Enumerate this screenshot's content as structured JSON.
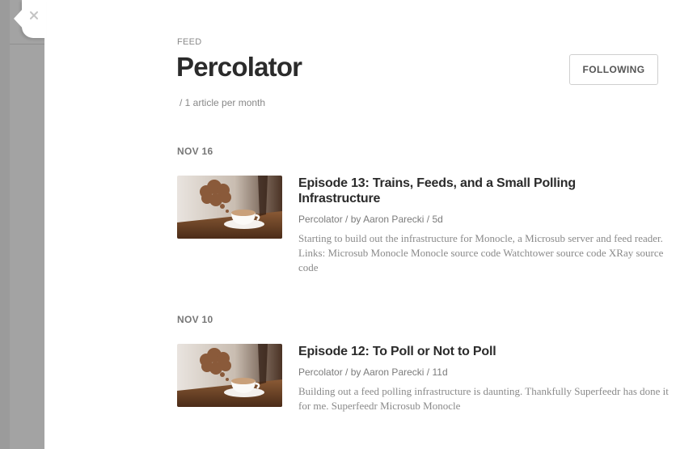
{
  "feed": {
    "label": "FEED",
    "title": "Percolator",
    "meta": "/ 1 article per month",
    "follow_label": "FOLLOWING"
  },
  "groups": [
    {
      "date": "NOV 16",
      "article": {
        "title": "Episode 13: Trains, Feeds, and a Small Polling Infrastructure",
        "source": "Percolator",
        "author": "by Aaron Parecki",
        "age": "5d",
        "summary": "Starting to build out the infrastructure for Monocle, a Microsub server and feed reader. Links: Microsub Monocle Monocle source code Watchtower source code XRay source code",
        "thumbnail": "coffee-cup-thought-bubble-image"
      }
    },
    {
      "date": "NOV 10",
      "article": {
        "title": "Episode 12: To Poll or Not to Poll",
        "source": "Percolator",
        "author": "by Aaron Parecki",
        "age": "11d",
        "summary": "Building out a feed polling infrastructure is daunting. Thankfully Superfeedr has done it for me. Superfeedr Microsub Monocle",
        "thumbnail": "coffee-cup-thought-bubble-image"
      }
    }
  ],
  "byline_separator": "/",
  "icons": {
    "close": "close-icon"
  },
  "colors": {
    "backdrop": "#9a9a9a",
    "panel": "#ffffff",
    "title": "#2b2b2b",
    "muted": "#888888"
  }
}
